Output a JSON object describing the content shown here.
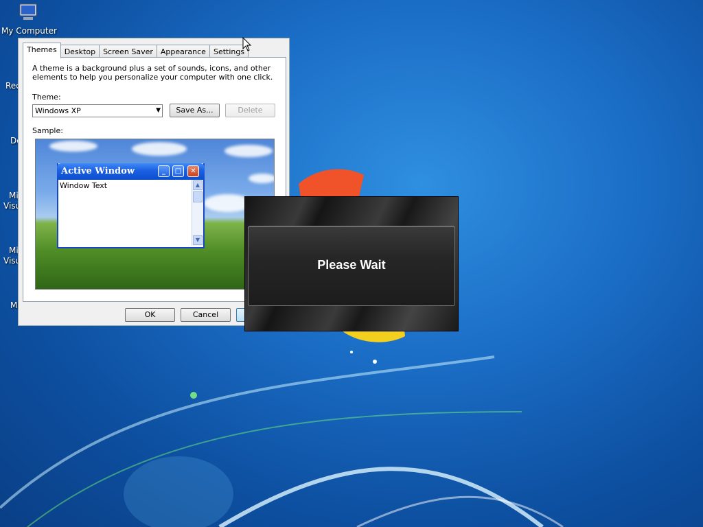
{
  "desktop": {
    "icons": [
      {
        "label": "My Computer"
      },
      {
        "label": "Rec"
      },
      {
        "label": "De"
      },
      {
        "label": "Mi"
      },
      {
        "label": "Visu"
      },
      {
        "label": "Mi"
      },
      {
        "label": "Visu"
      },
      {
        "label": "M"
      }
    ]
  },
  "dialog": {
    "tabs": [
      {
        "label": "Themes",
        "active": true
      },
      {
        "label": "Desktop"
      },
      {
        "label": "Screen Saver"
      },
      {
        "label": "Appearance"
      },
      {
        "label": "Settings"
      }
    ],
    "description": "A theme is a background plus a set of sounds, icons, and other elements to help you personalize your computer with one click.",
    "theme_label": "Theme:",
    "theme_value": "Windows XP",
    "save_as_label": "Save As...",
    "delete_label": "Delete",
    "sample_label": "Sample:",
    "sample_window": {
      "title": "Active Window",
      "body_text": "Window Text"
    },
    "ok_label": "OK",
    "cancel_label": "Cancel"
  },
  "overlay": {
    "message": "Please Wait"
  },
  "colors": {
    "xp_title_blue": "#1c5fe0",
    "overlay_dark": "#1c1c1c"
  }
}
